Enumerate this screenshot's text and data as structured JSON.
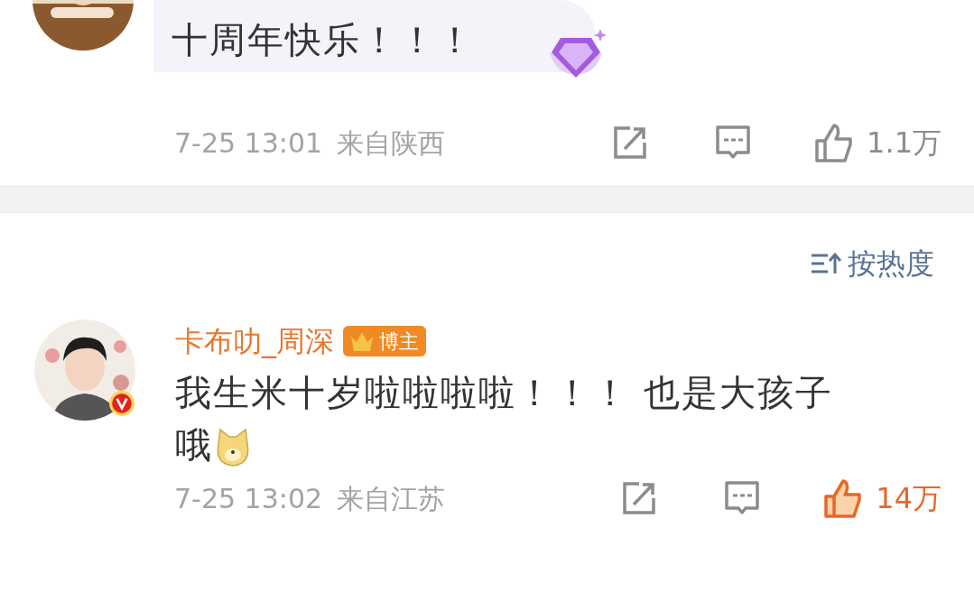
{
  "comments": [
    {
      "body": "十周年快乐！！！",
      "emoji": false,
      "highlight": true,
      "verified": false,
      "time": "7-25 13:01",
      "location": "来自陕西",
      "likes": "1.1万",
      "liked": false
    },
    {
      "name": "卡布叻_周深",
      "tag": "博主",
      "body": "我生米十岁啦啦啦啦！！！ 也是大孩子哦",
      "emoji": true,
      "highlight": false,
      "verified": true,
      "time": "7-25 13:02",
      "location": "来自江苏",
      "likes": "14万",
      "liked": true
    }
  ],
  "sort": {
    "label": "按热度"
  }
}
